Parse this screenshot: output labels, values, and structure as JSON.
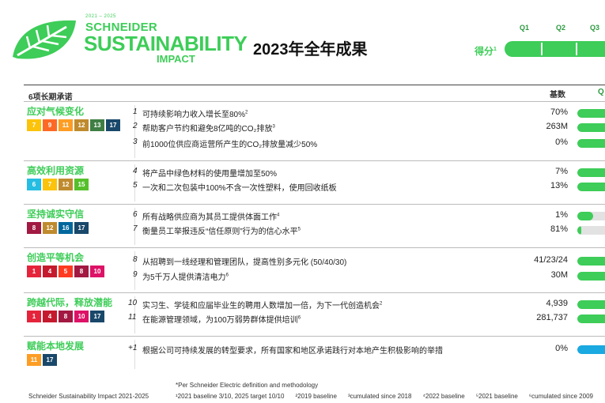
{
  "logo": {
    "years": "2021 – 2025",
    "brand": "SCHNEIDER",
    "title": "SUSTAINABILITY",
    "subtitle": "IMPACT"
  },
  "page_title": "2023年全年成果",
  "quarters": [
    "Q1",
    "Q2",
    "Q3"
  ],
  "score_label": "得分",
  "score_sup": "1",
  "commitments_header": "6项长期承诺",
  "baseline_header": "基数",
  "q_column_header": "Q",
  "colors": {
    "accent": "#3dcd58",
    "blue_bar": "#1aa9e0",
    "track": "#e2e2e2"
  },
  "sections": [
    {
      "title": "应对气候变化",
      "icons": [
        {
          "label": "7",
          "color": "#fcc30b",
          "name": "sdg-7-icon"
        },
        {
          "label": "9",
          "color": "#fd6925",
          "name": "sdg-9-icon"
        },
        {
          "label": "11",
          "color": "#fd9d24",
          "name": "sdg-11-icon"
        },
        {
          "label": "12",
          "color": "#bf8b2e",
          "name": "sdg-12-icon"
        },
        {
          "label": "13",
          "color": "#3f7e44",
          "name": "sdg-13-icon"
        },
        {
          "label": "17",
          "color": "#19486a",
          "name": "sdg-17-icon"
        }
      ],
      "rows": [
        {
          "num": "1",
          "text": "可持续影响力收入增长至80%",
          "sup": "2",
          "baseline": "70%",
          "progress": 1.0
        },
        {
          "num": "2",
          "text": "帮助客户节约和避免8亿吨的CO₂排放",
          "sup": "3",
          "baseline": "263M",
          "progress": 1.0
        },
        {
          "num": "3",
          "text": "前1000位供应商运营所产生的CO₂排放量减少50%",
          "sup": "",
          "baseline": "0%",
          "progress": 1.0
        }
      ]
    },
    {
      "title": "高效利用资源",
      "icons": [
        {
          "label": "6",
          "color": "#26bde2",
          "name": "sdg-6-icon"
        },
        {
          "label": "7",
          "color": "#fcc30b",
          "name": "sdg-7-icon"
        },
        {
          "label": "12",
          "color": "#bf8b2e",
          "name": "sdg-12-icon"
        },
        {
          "label": "15",
          "color": "#56c02b",
          "name": "sdg-15-icon"
        }
      ],
      "rows": [
        {
          "num": "4",
          "text": "将产品中绿色材料的使用量增加至50%",
          "sup": "",
          "baseline": "7%",
          "progress": 1.0
        },
        {
          "num": "5",
          "text": "一次和二次包装中100%不含一次性塑料，使用回收纸板",
          "sup": "",
          "baseline": "13%",
          "progress": 1.0
        }
      ]
    },
    {
      "title": "坚持诚实守信",
      "icons": [
        {
          "label": "8",
          "color": "#a21942",
          "name": "sdg-8-icon"
        },
        {
          "label": "12",
          "color": "#bf8b2e",
          "name": "sdg-12-icon"
        },
        {
          "label": "16",
          "color": "#00689d",
          "name": "sdg-16-icon"
        },
        {
          "label": "17",
          "color": "#19486a",
          "name": "sdg-17-icon"
        }
      ],
      "rows": [
        {
          "num": "6",
          "text": "所有战略供应商为其员工提供体面工作",
          "sup": "4",
          "baseline": "1%",
          "progress": 0.45
        },
        {
          "num": "7",
          "text": "衡量员工举报违反“信任原则”行为的信心水平",
          "sup": "5",
          "baseline": "81%",
          "progress": 0.1
        }
      ]
    },
    {
      "title": "创造平等机会",
      "icons": [
        {
          "label": "1",
          "color": "#e5243b",
          "name": "sdg-1-icon"
        },
        {
          "label": "4",
          "color": "#c5192d",
          "name": "sdg-4-icon"
        },
        {
          "label": "5",
          "color": "#ff3a21",
          "name": "sdg-5-icon"
        },
        {
          "label": "8",
          "color": "#a21942",
          "name": "sdg-8-icon"
        },
        {
          "label": "10",
          "color": "#dd1367",
          "name": "sdg-10-icon"
        }
      ],
      "rows": [
        {
          "num": "8",
          "text": "从招聘到一线经理和管理团队，提高性别多元化 (50/40/30)",
          "sup": "",
          "baseline": "41/23/24",
          "progress": 1.0
        },
        {
          "num": "9",
          "text": "为5千万人提供清洁电力",
          "sup": "6",
          "baseline": "30M",
          "progress": 1.0
        }
      ]
    },
    {
      "title": "跨越代际，释放潜能",
      "icons": [
        {
          "label": "1",
          "color": "#e5243b",
          "name": "sdg-1-icon"
        },
        {
          "label": "4",
          "color": "#c5192d",
          "name": "sdg-4-icon"
        },
        {
          "label": "8",
          "color": "#a21942",
          "name": "sdg-8-icon"
        },
        {
          "label": "10",
          "color": "#dd1367",
          "name": "sdg-10-icon"
        },
        {
          "label": "17",
          "color": "#19486a",
          "name": "sdg-17-icon"
        }
      ],
      "rows": [
        {
          "num": "10",
          "text": "实习生、学徒和应届毕业生的聘用人数增加一倍，为下一代创造机会",
          "sup": "2",
          "baseline": "4,939",
          "progress": 1.0
        },
        {
          "num": "11",
          "text": "在能源管理领域，为100万弱势群体提供培训",
          "sup": "6",
          "baseline": "281,737",
          "progress": 1.0
        }
      ]
    },
    {
      "title": "赋能本地发展",
      "icons": [
        {
          "label": "11",
          "color": "#fd9d24",
          "name": "sdg-11-icon"
        },
        {
          "label": "17",
          "color": "#19486a",
          "name": "sdg-17-icon"
        }
      ],
      "rows": [
        {
          "num": "+1",
          "text": "根据公司可持续发展的转型要求，所有国家和地区承诺践行对本地产生积极影响的举措",
          "sup": "",
          "baseline": "0%",
          "progress": 1.0,
          "blue": true
        }
      ]
    }
  ],
  "footer": {
    "left": "Schneider Sustainability Impact 2021-2025",
    "note": "*Per Schneider Electric definition and methodology",
    "footnotes": [
      "¹2021 baseline 3/10, 2025 target 10/10",
      "²2019 baseline",
      "³cumulated since 2018",
      "⁴2022 baseline",
      "⁵2021 baseline",
      "⁶cumulated since 2009"
    ]
  }
}
